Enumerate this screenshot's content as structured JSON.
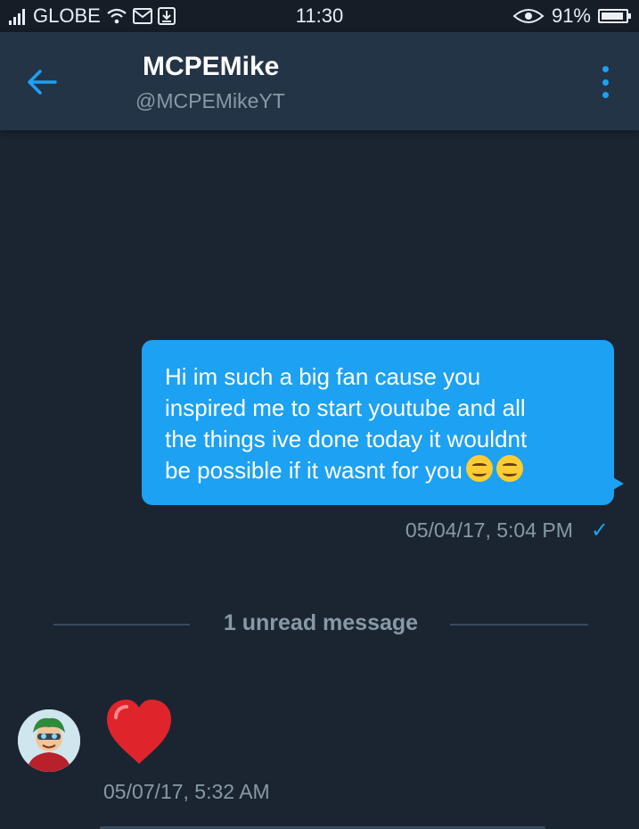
{
  "status_bar": {
    "carrier": "GLOBE",
    "time": "11:30",
    "battery_percent": "91%",
    "battery_level": 0.91,
    "icons": [
      "signal-icon",
      "wifi-icon",
      "gmail-icon",
      "download-icon",
      "eye-icon",
      "battery-icon"
    ]
  },
  "header": {
    "name": "MCPEMike",
    "handle": "@MCPEMikeYT",
    "back_icon": "arrow-left-icon",
    "menu_icon": "more-vertical-icon"
  },
  "messages": [
    {
      "direction": "outgoing",
      "text_lines": [
        "Hi im such a big fan cause you",
        "inspired me to start youtube and all",
        "the things ive done today it wouldnt",
        "be possible if it wasnt for you"
      ],
      "emoji": [
        "smiling-face-icon",
        "smiling-face-icon"
      ],
      "timestamp": "05/04/17, 5:04 PM",
      "status_icon": "checkmark-icon"
    },
    {
      "direction": "incoming",
      "emoji": "red-heart-icon",
      "timestamp": "05/07/17, 5:32 AM",
      "avatar": "avatar-icon"
    }
  ],
  "divider": {
    "label": "1 unread message"
  },
  "colors": {
    "background": "#1b2531",
    "header": "#243447",
    "accent": "#1da1f2",
    "muted_text": "#8899a6",
    "heart": "#e0242c"
  }
}
